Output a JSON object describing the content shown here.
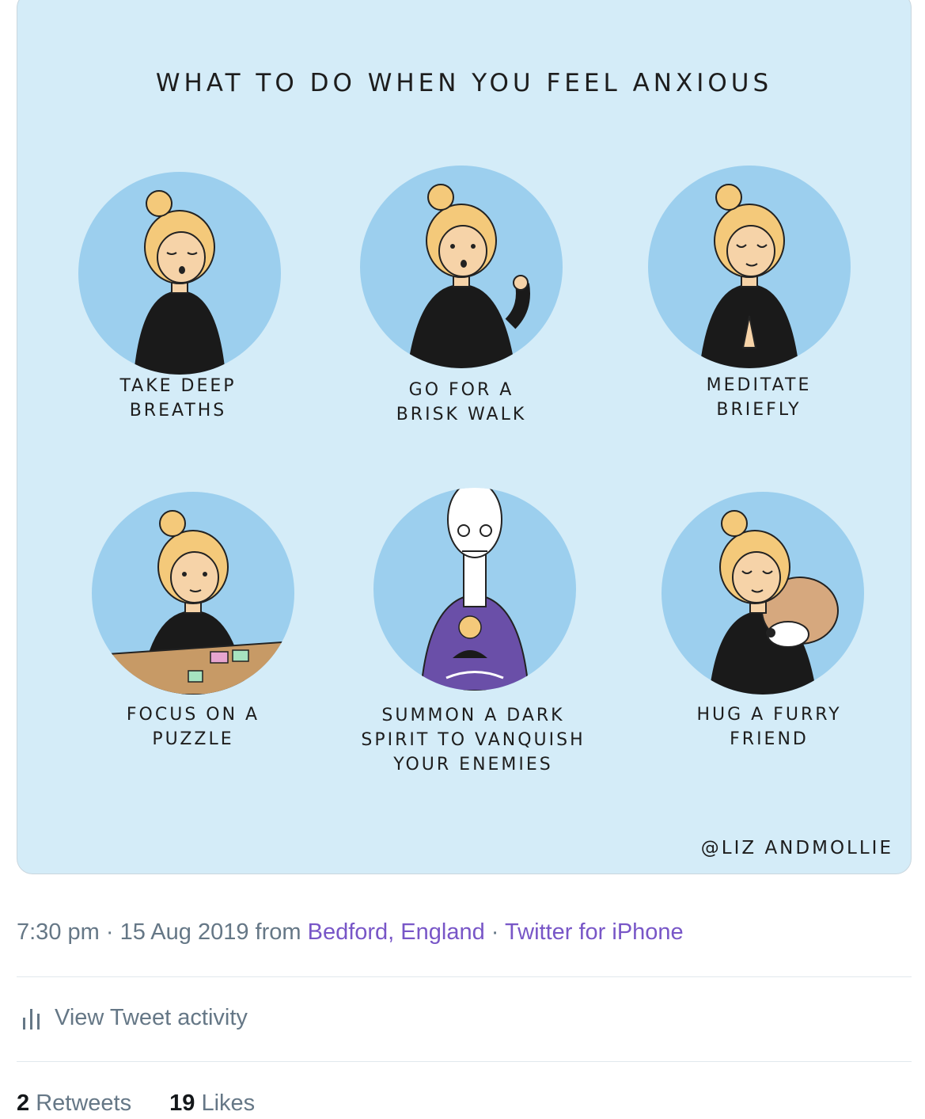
{
  "comic": {
    "title": "WHAT TO DO WHEN YOU FEEL ANXIOUS",
    "panels": [
      {
        "caption": "TAKE DEEP\nBREATHS"
      },
      {
        "caption": "GO FOR A\nBRISK WALK"
      },
      {
        "caption": "MEDITATE\nBRIEFLY"
      },
      {
        "caption": "FOCUS ON A\nPUZZLE"
      },
      {
        "caption": "SUMMON A DARK\nSPIRIT TO VANQUISH\nYOUR ENEMIES"
      },
      {
        "caption": "HUG A FURRY\nFRIEND"
      }
    ],
    "credit": "@LIZ ANDMOLLIE"
  },
  "tweet": {
    "time": "7:30 pm",
    "date": "15 Aug 2019",
    "from_label": "from",
    "location": "Bedford, England",
    "client": "Twitter for iPhone",
    "sep": "·",
    "activity_label": "View Tweet activity",
    "retweets_count": "2",
    "retweets_label": "Retweets",
    "likes_count": "19",
    "likes_label": "Likes"
  },
  "colors": {
    "link": "#7856c7",
    "muted": "#657786",
    "card_bg": "#d4ecf8",
    "circle": "#9ccfee"
  },
  "icons": {
    "activity": "bar-chart-icon"
  }
}
